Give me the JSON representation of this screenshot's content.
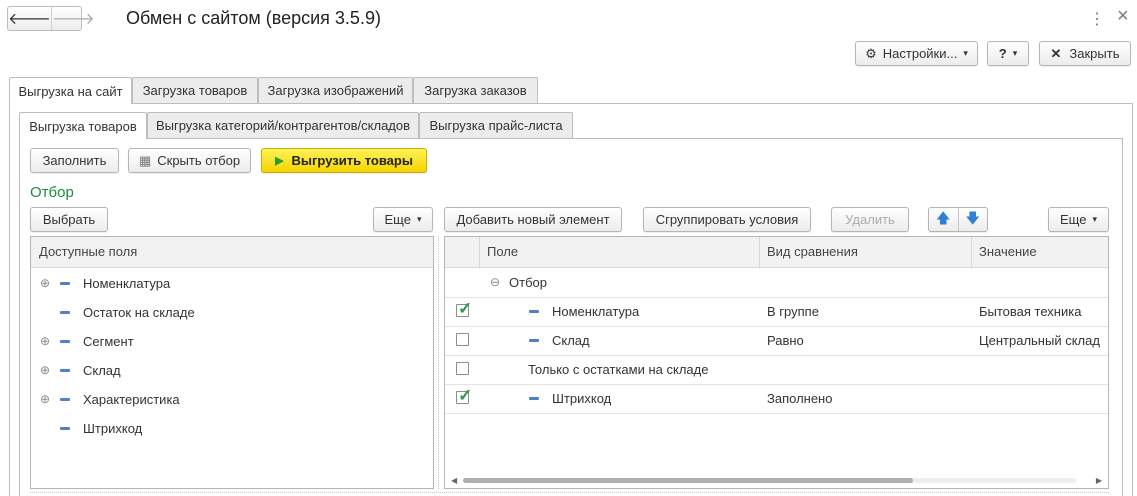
{
  "window": {
    "title": "Обмен с сайтом (версия 3.5.9)",
    "back_icon": "arrow-left-icon",
    "forward_icon": "arrow-right-icon",
    "menu_glyph": "⋮",
    "close_glyph": "×"
  },
  "header_buttons": {
    "settings": "Настройки...",
    "help": "?",
    "close": "Закрыть"
  },
  "tabs": [
    {
      "label": "Выгрузка на сайт",
      "active": true
    },
    {
      "label": "Загрузка товаров",
      "active": false
    },
    {
      "label": "Загрузка изображений",
      "active": false
    },
    {
      "label": "Загрузка заказов",
      "active": false
    }
  ],
  "subtabs": [
    {
      "label": "Выгрузка товаров",
      "active": true
    },
    {
      "label": "Выгрузка категорий/контрагентов/складов",
      "active": false
    },
    {
      "label": "Выгрузка прайс-листа",
      "active": false
    }
  ],
  "toolbar": {
    "fill": "Заполнить",
    "hide_filter": "Скрыть отбор",
    "export_goods": "Выгрузить товары"
  },
  "filter_title": "Отбор",
  "left_toolbar": {
    "choose": "Выбрать",
    "more": "Еще"
  },
  "right_toolbar": {
    "add_new": "Добавить новый элемент",
    "group": "Сгруппировать условия",
    "delete": "Удалить",
    "more": "Еще"
  },
  "available_fields": {
    "header": "Доступные поля",
    "items": [
      {
        "label": "Номенклатура",
        "expandable": true
      },
      {
        "label": "Остаток на складе",
        "expandable": false
      },
      {
        "label": "Сегмент",
        "expandable": true
      },
      {
        "label": "Склад",
        "expandable": true
      },
      {
        "label": "Характеристика",
        "expandable": true
      },
      {
        "label": "Штрихкод",
        "expandable": false
      }
    ]
  },
  "conditions": {
    "columns": [
      "Поле",
      "Вид сравнения",
      "Значение"
    ],
    "root_label": "Отбор",
    "rows": [
      {
        "checked": true,
        "field": "Номенклатура",
        "comparison": "В группе",
        "value": "Бытовая техника"
      },
      {
        "checked": false,
        "field": "Склад",
        "comparison": "Равно",
        "value": "Центральный склад"
      },
      {
        "checked": false,
        "field": "Только с остатками на складе",
        "comparison": "",
        "value": ""
      },
      {
        "checked": true,
        "field": "Штрихкод",
        "comparison": "Заполнено",
        "value": ""
      }
    ]
  },
  "colors": {
    "accent_green": "#1a8f3c",
    "primary_button": "#ffe033",
    "field_icon": "#4f80c8",
    "check_green": "#2a9a4a"
  }
}
